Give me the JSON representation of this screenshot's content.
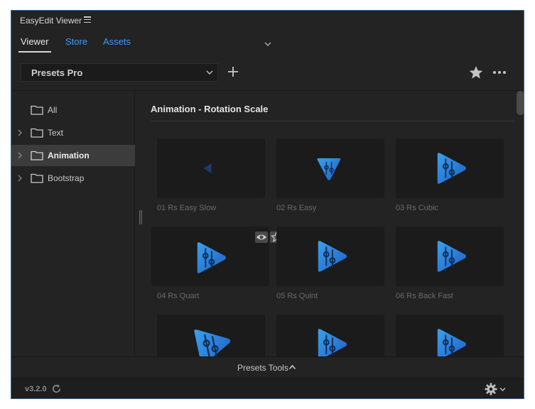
{
  "app": {
    "title": "EasyEdit Viewer"
  },
  "tabs": [
    {
      "label": "Viewer",
      "active": true
    },
    {
      "label": "Store",
      "active": false
    },
    {
      "label": "Assets",
      "active": false
    }
  ],
  "toolbar": {
    "preset_dropdown": {
      "selected": "Presets Pro"
    },
    "icons": [
      "add-icon",
      "star-icon",
      "more-icon"
    ]
  },
  "sidebar": {
    "items": [
      {
        "label": "All",
        "expandable": false,
        "selected": false
      },
      {
        "label": "Text",
        "expandable": true,
        "selected": false
      },
      {
        "label": "Animation",
        "expandable": true,
        "selected": true
      },
      {
        "label": "Bootstrap",
        "expandable": true,
        "selected": false
      }
    ]
  },
  "main": {
    "section_title": "Animation - Rotation Scale",
    "presets": [
      {
        "label": "01 Rs Easy Slow"
      },
      {
        "label": "02 Rs Easy"
      },
      {
        "label": "03 Rs Cubic"
      },
      {
        "label": "04 Rs Quart"
      },
      {
        "label": "05 Rs Quint"
      },
      {
        "label": "06 Rs Back Fast"
      },
      {
        "label": ""
      },
      {
        "label": ""
      },
      {
        "label": ""
      }
    ]
  },
  "footer": {
    "tools_label": "Presets Tools"
  },
  "status": {
    "version": "v3.2.0"
  },
  "colors": {
    "accent_link": "#3d9bff",
    "panel_bg": "#232323",
    "thumb_bg": "#1b1b1b",
    "logo_gradient": [
      "#1f6fd1",
      "#3aa0ec"
    ]
  }
}
